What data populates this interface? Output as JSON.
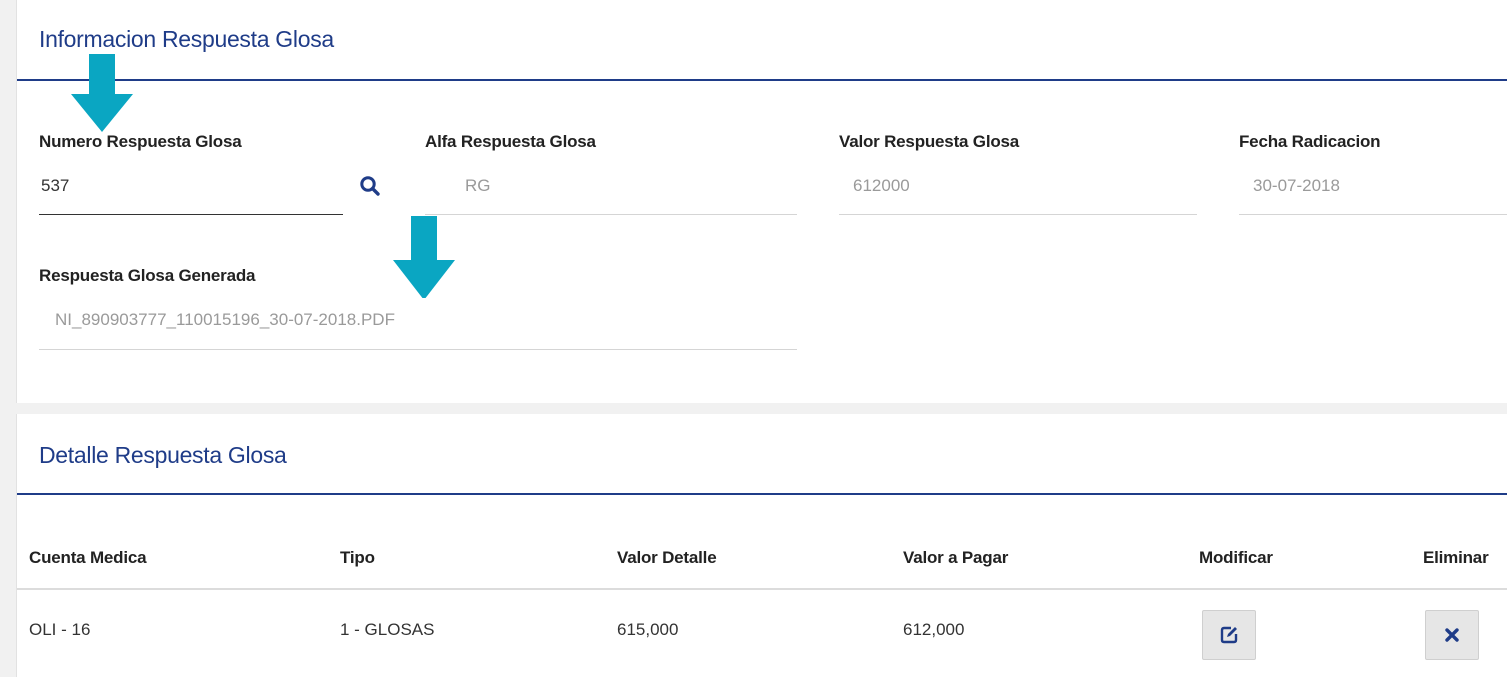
{
  "info_section": {
    "title": "Informacion Respuesta Glosa",
    "fields": {
      "numero": {
        "label": "Numero Respuesta Glosa",
        "value": "537"
      },
      "alfa": {
        "label": "Alfa Respuesta Glosa",
        "value": "RG"
      },
      "valor": {
        "label": "Valor Respuesta Glosa",
        "value": "612000"
      },
      "fecha": {
        "label": "Fecha Radicacion",
        "value": "30-07-2018"
      },
      "generada": {
        "label": "Respuesta Glosa Generada",
        "value": "NI_890903777_110015196_30-07-2018.PDF"
      }
    }
  },
  "detail_section": {
    "title": "Detalle Respuesta Glosa",
    "columns": [
      "Cuenta Medica",
      "Tipo",
      "Valor Detalle",
      "Valor a Pagar",
      "Modificar",
      "Eliminar"
    ],
    "rows": [
      {
        "cuenta": "OLI - 16",
        "tipo": "1 - GLOSAS",
        "valor_detalle": "615,000",
        "valor_pagar": "612,000"
      }
    ]
  },
  "icons": {
    "search": "search-icon",
    "edit": "edit-icon",
    "delete": "close-icon",
    "annotation": "arrow-down-icon"
  },
  "colors": {
    "accent": "#1f3c88",
    "arrow": "#0aa6c2"
  }
}
